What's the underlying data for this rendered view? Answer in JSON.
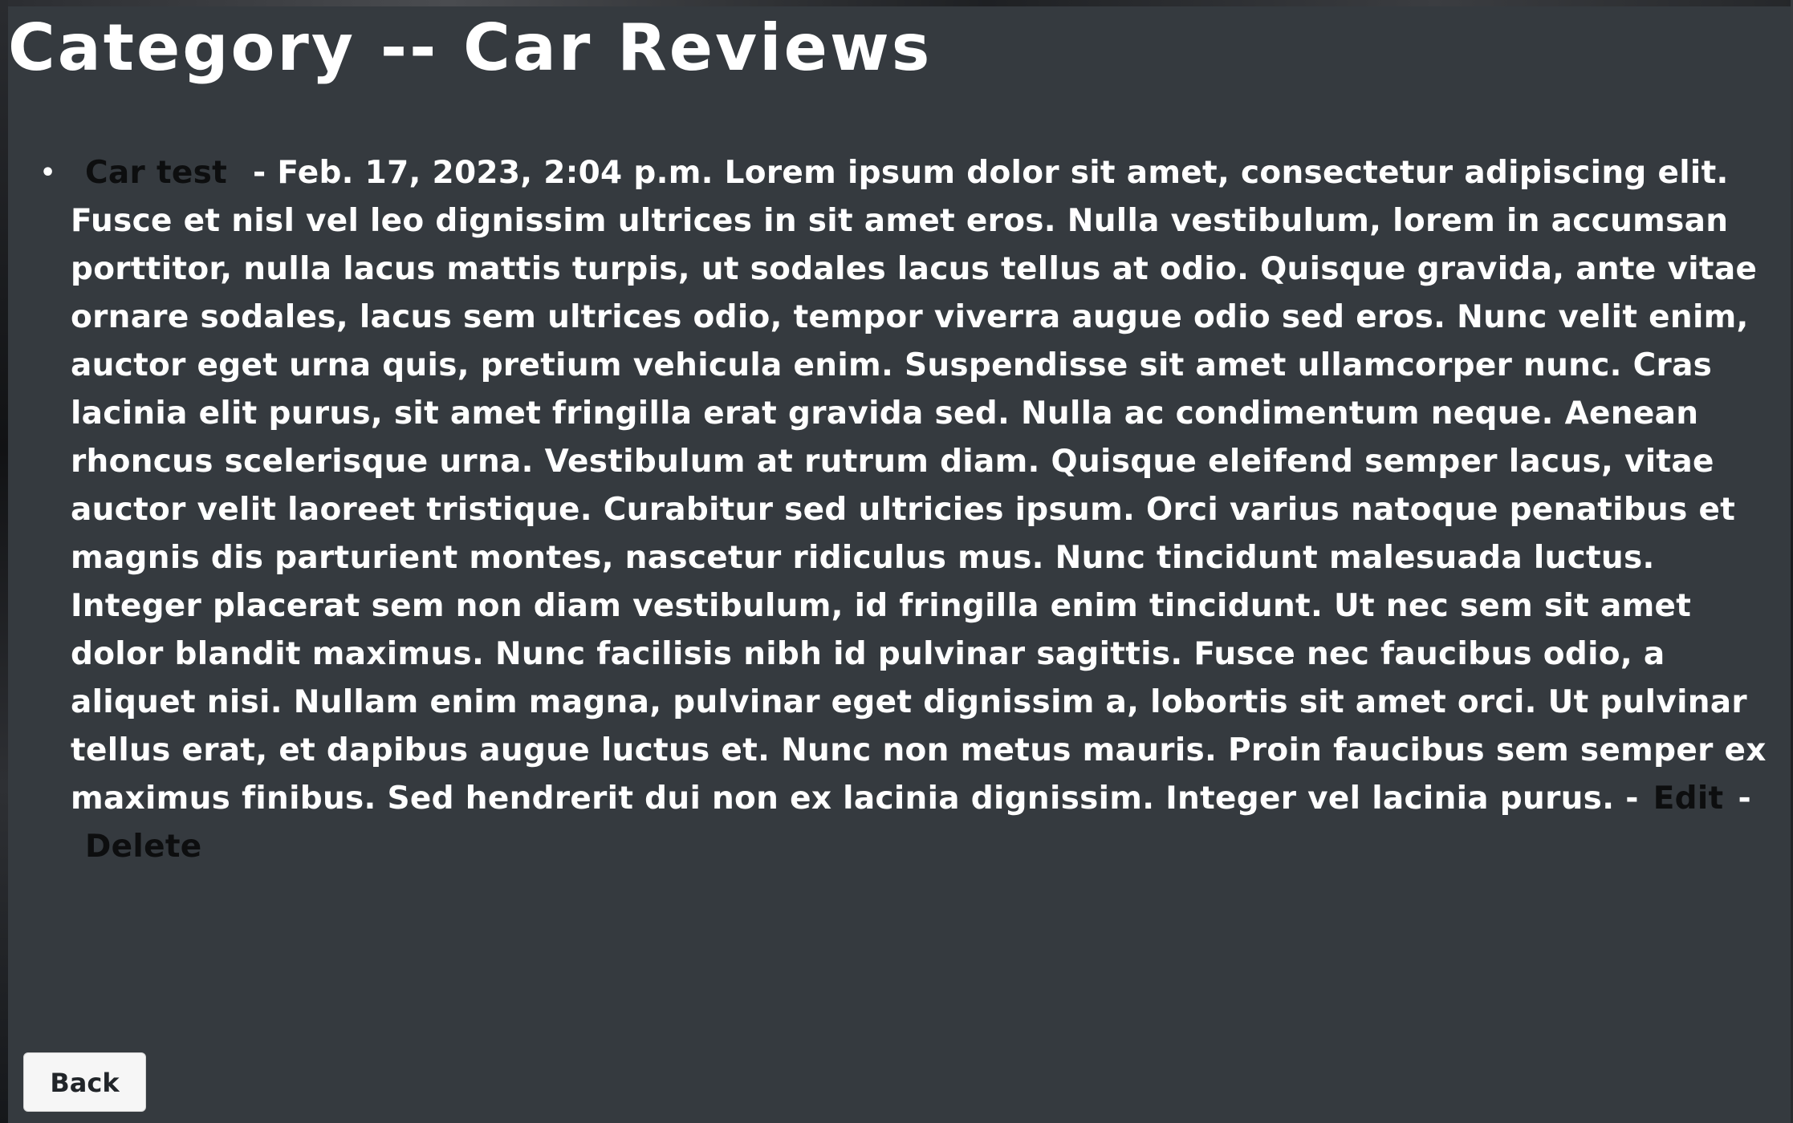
{
  "page": {
    "title": "Category -- Car Reviews"
  },
  "reviews": [
    {
      "title_link": "Car test",
      "meta_and_body": " - Feb. 17, 2023, 2:04 p.m. Lorem ipsum dolor sit amet, consectetur adipiscing elit. Fusce et nisl vel leo dignissim ultrices in sit amet eros. Nulla vestibulum, lorem in accumsan porttitor, nulla lacus mattis turpis, ut sodales lacus tellus at odio. Quisque gravida, ante vitae ornare sodales, lacus sem ultrices odio, tempor viverra augue odio sed eros. Nunc velit enim, auctor eget urna quis, pretium vehicula enim. Suspendisse sit amet ullamcorper nunc. Cras lacinia elit purus, sit amet fringilla erat gravida sed. Nulla ac condimentum neque. Aenean rhoncus scelerisque urna. Vestibulum at rutrum diam. Quisque eleifend semper lacus, vitae auctor velit laoreet tristique. Curabitur sed ultricies ipsum. Orci varius natoque penatibus et magnis dis parturient montes, nascetur ridiculus mus. Nunc tincidunt malesuada luctus. Integer placerat sem non diam vestibulum, id fringilla enim tincidunt. Ut nec sem sit amet dolor blandit maximus. Nunc facilisis nibh id pulvinar sagittis. Fusce nec faucibus odio, a aliquet nisi. Nullam enim magna, pulvinar eget dignissim a, lobortis sit amet orci. Ut pulvinar tellus erat, et dapibus augue luctus et. Nunc non metus mauris. Proin faucibus sem semper ex maximus finibus. Sed hendrerit dui non ex lacinia dignissim. Integer vel lacinia purus. -",
      "edit_label": "Edit",
      "separator": "-",
      "delete_label": "Delete"
    }
  ],
  "actions": {
    "back_label": "Back"
  },
  "colors": {
    "panel_bg": "#353a3f",
    "text": "#ffffff",
    "link": "#0d0e0f",
    "button_bg": "#f6f6f6"
  }
}
